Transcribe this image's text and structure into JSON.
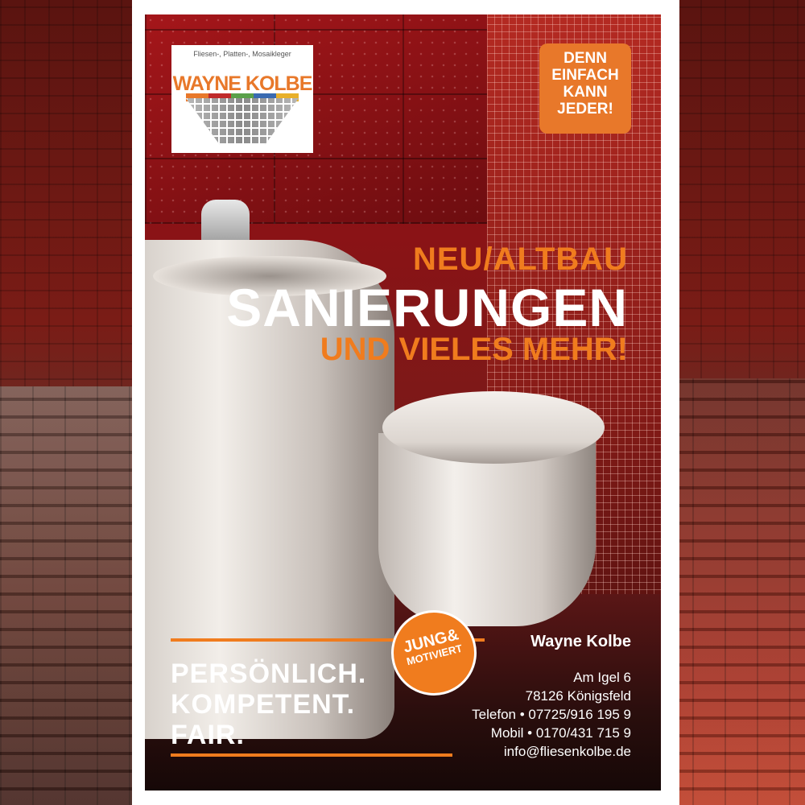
{
  "logo": {
    "subtitle": "Fliesen-, Platten-, Mosaikleger",
    "name": "WAYNE KOLBE"
  },
  "badge": {
    "lines": [
      "DENN",
      "EINFACH",
      "KANN",
      "JEDER!"
    ]
  },
  "headline": {
    "line1": "NEU/ALTBAU",
    "line2": "SANIERUNGEN",
    "line3": "UND VIELES MEHR!"
  },
  "slogan": {
    "lines": [
      "PERSÖNLICH.",
      "KOMPETENT.",
      "FAIR."
    ]
  },
  "stamp": {
    "line1": "JUNG&",
    "line2": "MOTIVIERT"
  },
  "contact": {
    "name": "Wayne Kolbe",
    "street": "Am Igel 6",
    "city": "78126 Königsfeld",
    "phone": "Telefon • 07725/916 195 9",
    "mobile": "Mobil • 0170/431 715 9",
    "email": "info@fliesenkolbe.de"
  },
  "colors": {
    "accent_orange": "#f07c1e",
    "tile_red": "#8c1216",
    "white": "#ffffff"
  }
}
